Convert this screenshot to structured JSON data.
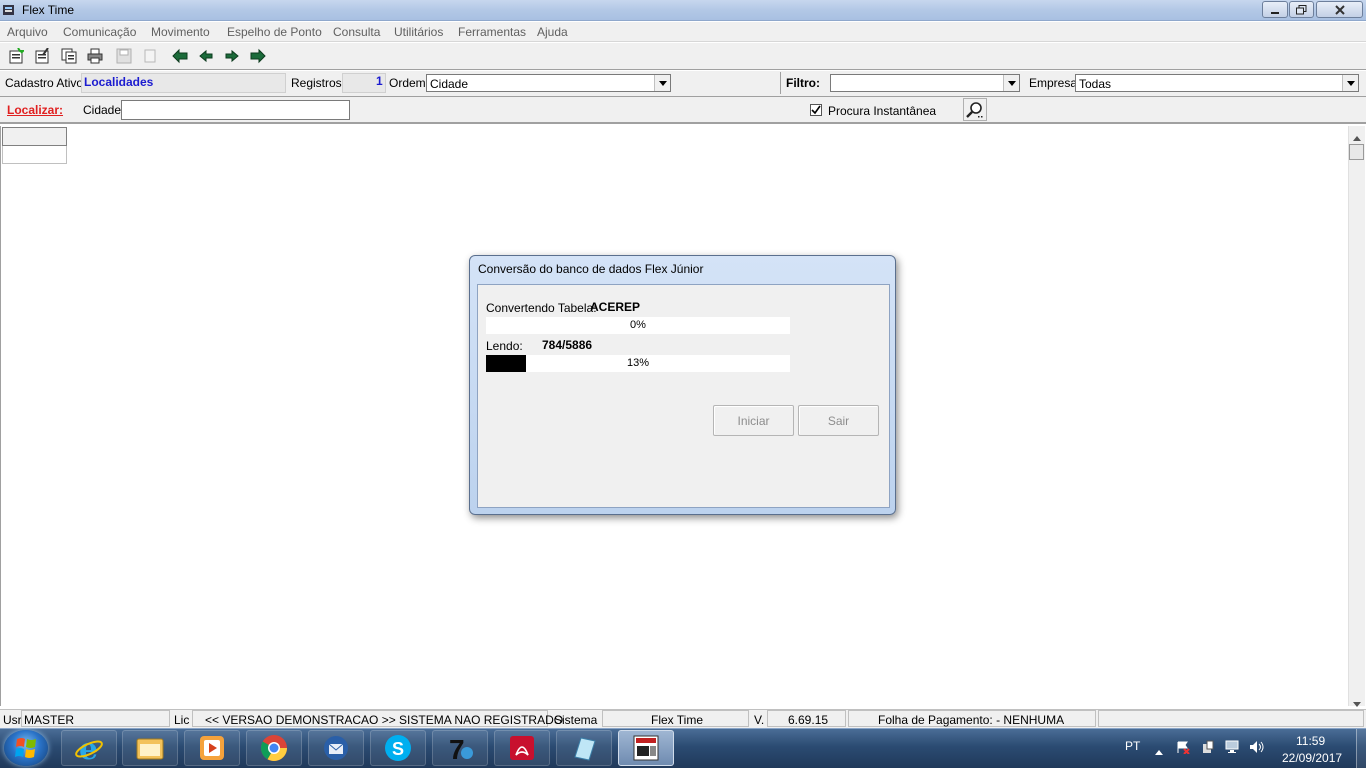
{
  "window": {
    "title": "Flex Time",
    "min_glyph": "—",
    "max_glyph": "▢",
    "close_glyph": "✕"
  },
  "menu": [
    "Arquivo",
    "Comunicação",
    "Movimento",
    "Espelho de Ponto",
    "Consulta",
    "Utilitários",
    "Ferramentas",
    "Ajuda"
  ],
  "toolbar_icons": [
    "new-record-icon",
    "edit-record-icon",
    "copy-record-icon",
    "print-icon",
    "save-icon",
    "cancel-icon",
    "first-record-icon",
    "prev-record-icon",
    "next-record-icon",
    "last-record-icon"
  ],
  "cadastro": {
    "label": "Cadastro Ativo:",
    "value": "Localidades",
    "registros_label": "Registros:",
    "registros_value": "1",
    "ordem_label": "Ordem:",
    "ordem_value": "Cidade",
    "filtro_label": "Filtro:",
    "filtro_value": "",
    "empresa_label": "Empresa:",
    "empresa_value": "Todas"
  },
  "localizar": {
    "label": "Localizar:",
    "field_label": "Cidade",
    "field_value": "",
    "checkbox_label": "Procura Instantânea",
    "checked": true
  },
  "dialog": {
    "title": "Conversão do banco de dados Flex Júnior",
    "table_label": "Convertendo Tabela:",
    "table_name": "ACEREP",
    "progress1_text": "0%",
    "progress1_value": 0,
    "reading_label": "Lendo:",
    "reading_value": "784/5886",
    "progress2_text": "13%",
    "progress2_value": 0.13,
    "iniciar_label": "Iniciar",
    "sair_label": "Sair"
  },
  "statusbar": {
    "usr_label": "Usr",
    "usr_value": "MASTER",
    "lic_label": "Lic",
    "lic_value": "<< VERSAO DEMONSTRACAO >> SISTEMA NAO REGISTRADO",
    "sistema_label": "Sistema",
    "sistema_value": "Flex Time",
    "version_label": "V.",
    "version_value": "6.69.15",
    "folha_value": "Folha de Pagamento:  - NENHUMA"
  },
  "taskbar": {
    "apps": [
      "internet-explorer-icon",
      "file-explorer-icon",
      "media-player-icon",
      "chrome-icon",
      "thunderbird-icon",
      "skype-icon",
      "7zip-icon",
      "adobe-reader-icon",
      "notepad-icon",
      "flex-time-icon"
    ],
    "lang": "PT",
    "time": "11:59",
    "date": "22/09/2017"
  }
}
